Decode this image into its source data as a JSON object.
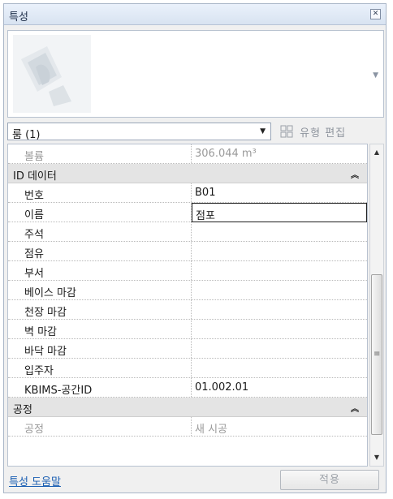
{
  "panel": {
    "title": "특성",
    "close_icon": "close-icon"
  },
  "type_selector": {
    "value": "룸 (1)",
    "edit_type_label": "유형 편집"
  },
  "properties": {
    "volume": {
      "label": "볼륨",
      "value": "306.044 m³"
    },
    "group_id": {
      "label": "ID 데이터"
    },
    "rows": [
      {
        "label": "번호",
        "value": "B01"
      },
      {
        "label": "이름",
        "value": "점포"
      },
      {
        "label": "주석",
        "value": ""
      },
      {
        "label": "점유",
        "value": ""
      },
      {
        "label": "부서",
        "value": ""
      },
      {
        "label": "베이스 마감",
        "value": ""
      },
      {
        "label": "천장 마감",
        "value": ""
      },
      {
        "label": "벽 마감",
        "value": ""
      },
      {
        "label": "바닥 마감",
        "value": ""
      },
      {
        "label": "입주자",
        "value": ""
      },
      {
        "label": "KBIMS-공간ID",
        "value": "01.002.01"
      }
    ],
    "group_phase": {
      "label": "공정"
    },
    "phase": {
      "label": "공정",
      "value": "새 시공"
    }
  },
  "footer": {
    "help_link": "특성 도움말",
    "apply_label": "적용"
  }
}
